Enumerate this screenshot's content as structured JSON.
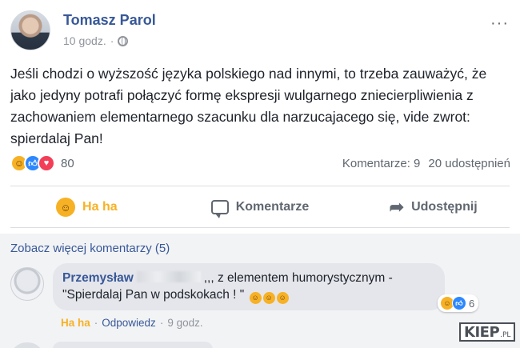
{
  "post": {
    "author": "Tomasz Parol",
    "time": "10 godz.",
    "separator": "·",
    "more_menu": "···",
    "text": "Jeśli chodzi o wyższość języka polskiego nad innymi, to trzeba zauważyć, że jako jedyny potrafi połączyć formę ekspresji wulgarnego zniecierpliwienia z zachowaniem elementarnego szacunku dla narzucajacego się, vide zwrot: spierdalaj Pan!",
    "reaction_count": "80",
    "comments_count": "Komentarze: 9",
    "shares_count": "20 udostępnień"
  },
  "actions": {
    "haha": "Ha ha",
    "comment": "Komentarze",
    "share": "Udostępnij"
  },
  "comments": {
    "more_comments": "Zobacz więcej komentarzy (5)",
    "items": [
      {
        "name": "Przemysław",
        "text_part1": ",,, z elementem humorystycznym -",
        "text_part2": "\"Spierdalaj Pan w podskokach ! \"",
        "reaction_count": "6",
        "reaction_label": "Ha ha",
        "reply_label": "Odpowiedz",
        "sep": "·",
        "time": "9 godz."
      }
    ]
  },
  "watermark": {
    "main": "KIEP",
    "suffix": ".PL"
  },
  "colors": {
    "link": "#385898",
    "haha": "#f7b125",
    "like": "#2d88ff",
    "love": "#f33e58",
    "muted": "#606770"
  },
  "icons": [
    "haha-icon",
    "like-icon",
    "love-icon",
    "comment-icon",
    "share-icon",
    "globe-icon",
    "more-icon"
  ]
}
